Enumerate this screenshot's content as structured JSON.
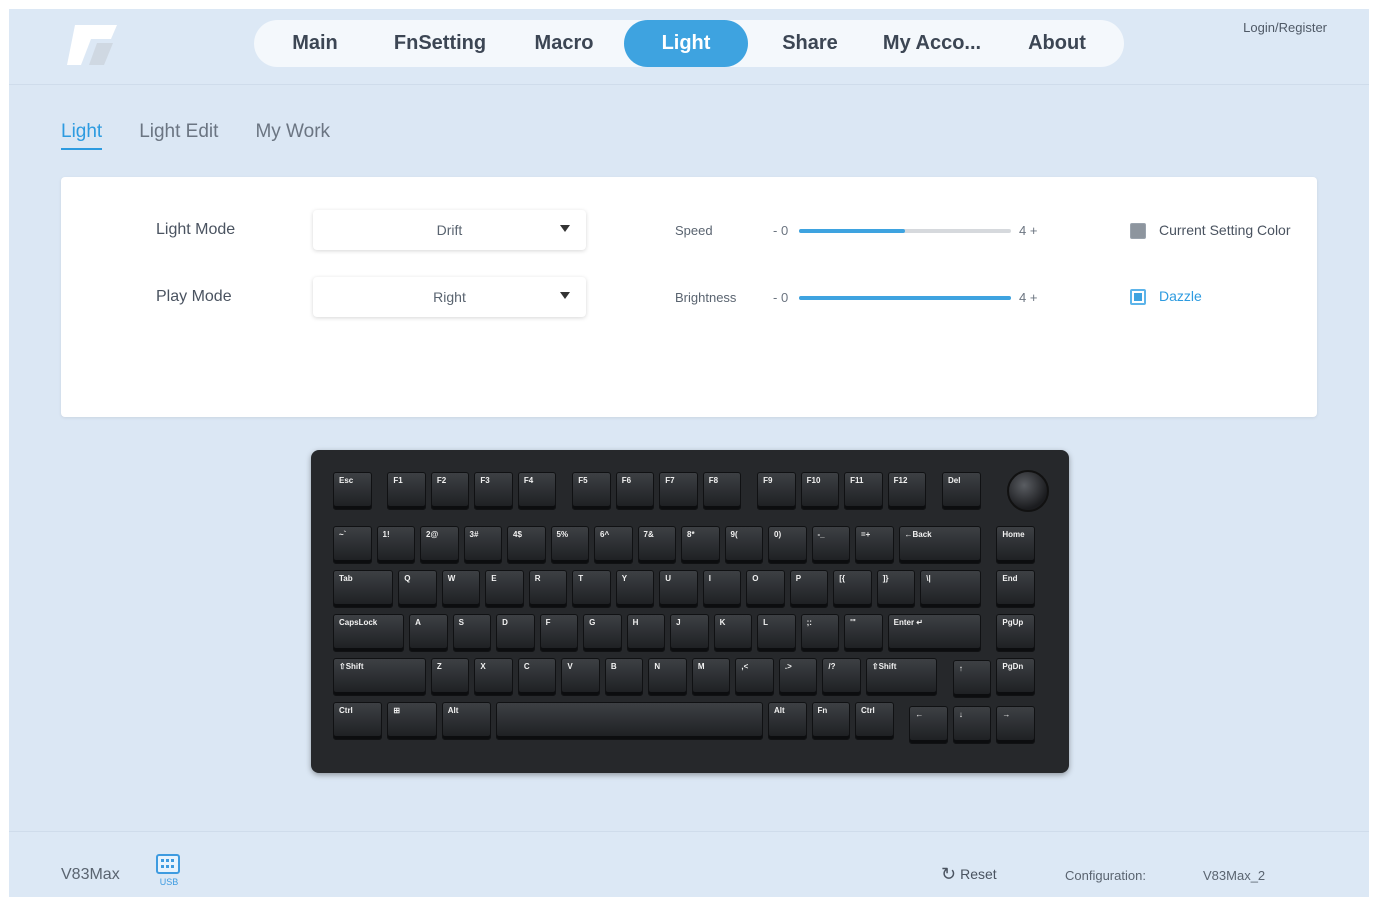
{
  "colors": {
    "accent": "#3ea3e0",
    "background": "#dbe7f4",
    "panel": "#ffffff",
    "keyboard": "#26282b"
  },
  "header": {
    "nav": [
      "Main",
      "FnSetting",
      "Macro",
      "Light",
      "Share",
      "My Acco...",
      "About"
    ],
    "active_nav": "Light",
    "login": "Login/Register"
  },
  "subtabs": {
    "items": [
      "Light",
      "Light Edit",
      "My Work"
    ],
    "active": "Light"
  },
  "settings": {
    "light_mode": {
      "label": "Light Mode",
      "value": "Drift"
    },
    "play_mode": {
      "label": "Play Mode",
      "value": "Right"
    },
    "speed": {
      "label": "Speed",
      "minus": "- 0",
      "plus": "4 +",
      "level_fraction": 0.5
    },
    "brightness": {
      "label": "Brightness",
      "minus": "- 0",
      "plus": "4 +",
      "level_fraction": 1.0
    },
    "current_setting_color": {
      "label": "Current Setting Color",
      "checked": false
    },
    "dazzle": {
      "label": "Dazzle",
      "checked": true
    }
  },
  "keyboard": {
    "rows": [
      [
        "Esc",
        "F1",
        "F2",
        "F3",
        "F4",
        "F5",
        "F6",
        "F7",
        "F8",
        "F9",
        "F10",
        "F11",
        "F12",
        "Del"
      ],
      [
        "~`",
        "1!",
        "2@",
        "3#",
        "4$",
        "5%",
        "6^",
        "7&",
        "8*",
        "9(",
        "0)",
        "-_",
        "=+",
        "←Back",
        "Home"
      ],
      [
        "Tab",
        "Q",
        "W",
        "E",
        "R",
        "T",
        "Y",
        "U",
        "I",
        "O",
        "P",
        "[{",
        "]}",
        "\\|",
        "End"
      ],
      [
        "CapsLock",
        "A",
        "S",
        "D",
        "F",
        "G",
        "H",
        "J",
        "K",
        "L",
        ";:",
        "'\"",
        "Enter ↵",
        "PgUp"
      ],
      [
        "⇧Shift",
        "Z",
        "X",
        "C",
        "V",
        "B",
        "N",
        "M",
        ",<",
        ".>",
        "/?",
        "⇧Shift",
        "↑",
        "PgDn"
      ],
      [
        "Ctrl",
        "⊞",
        "Alt",
        "",
        "Alt",
        "Fn",
        "Ctrl",
        "←",
        "↓",
        "→"
      ]
    ]
  },
  "footer": {
    "device": "V83Max",
    "connection": "USB",
    "reset": "Reset",
    "configuration_label": "Configuration:",
    "configuration_value": "V83Max_2"
  }
}
